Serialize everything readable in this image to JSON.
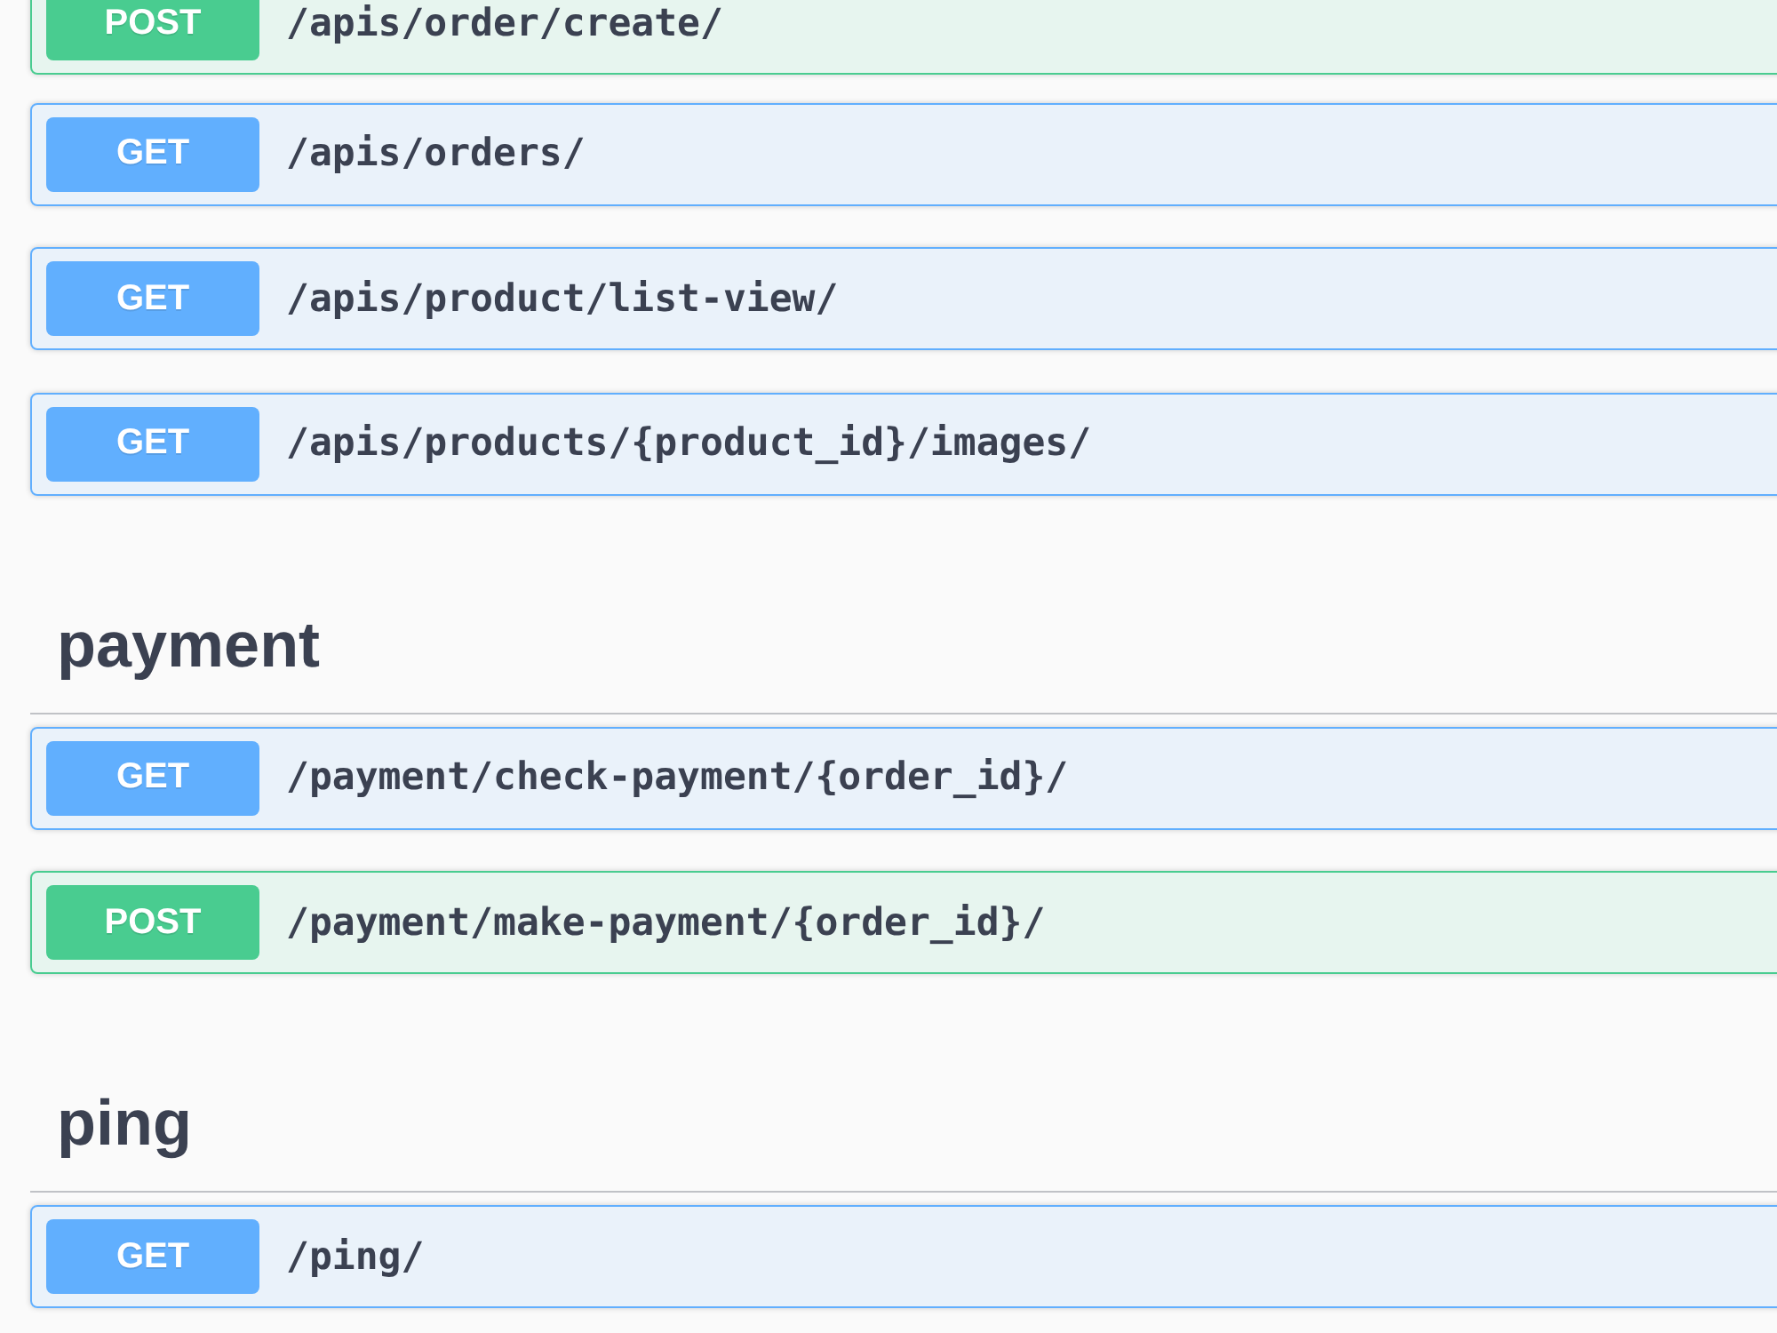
{
  "sections": [
    {
      "endpoints": [
        {
          "method": "POST",
          "color": "#49cc90",
          "path": "/apis/order/create/"
        },
        {
          "method": "GET",
          "color": "#61affe",
          "path": "/apis/orders/"
        },
        {
          "method": "GET",
          "color": "#61affe",
          "path": "/apis/product/list-view/"
        },
        {
          "method": "GET",
          "color": "#61affe",
          "path": "/apis/products/{product_id}/images/"
        }
      ]
    },
    {
      "tag": "payment",
      "endpoints": [
        {
          "method": "GET",
          "color": "#61affe",
          "path": "/payment/check-payment/{order_id}/"
        },
        {
          "method": "POST",
          "color": "#49cc90",
          "path": "/payment/make-payment/{order_id}/"
        }
      ]
    },
    {
      "tag": "ping",
      "endpoints": [
        {
          "method": "GET",
          "color": "#61affe",
          "path": "/ping/"
        }
      ]
    }
  ]
}
